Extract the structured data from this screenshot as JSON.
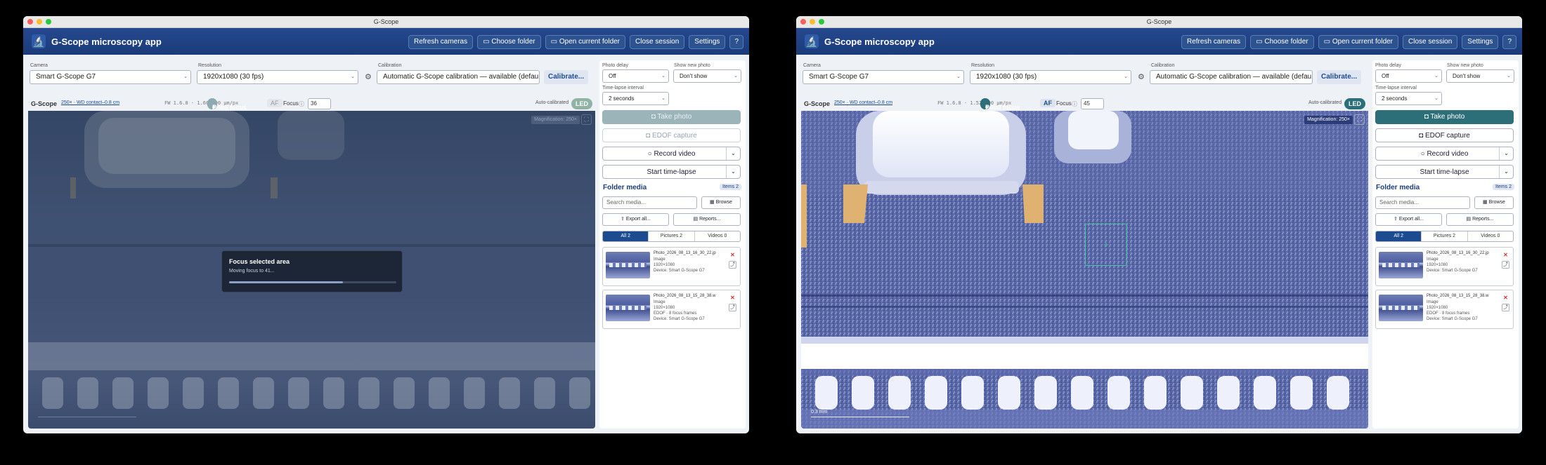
{
  "windows": [
    {
      "title": "G-Scope",
      "app_title": "G-Scope microscopy app",
      "top_buttons": [
        "Refresh cameras",
        "Choose folder",
        "Open current folder",
        "Close session",
        "Settings",
        "?"
      ],
      "camera_label": "Camera",
      "camera_value": "Smart G-Scope G7",
      "resolution_label": "Resolution",
      "resolution_value": "1920x1080 (30 fps)",
      "calibration_label": "Calibration",
      "calibration_value": "Automatic G-Scope calibration — available (defau",
      "calibrate_button": "Calibrate...",
      "brand": "G-Scope",
      "mag_link": "250× · WD contact–0.8 cm",
      "fw": "FW 1.6.8 · 1.602500 µm/px",
      "point_focus": "Point focus",
      "af": "AF",
      "focus_label": "Focus",
      "focus_value": "36",
      "auto_calibrated": "Auto-calibrated",
      "led": "LED",
      "magnification_tag": "Magnification: 250×",
      "scale_label": "",
      "overlay": {
        "title": "Focus selected area",
        "subtitle": "Moving focus to 41...",
        "progress": 0.68
      },
      "photo_delay_label": "Photo delay",
      "photo_delay_value": "Off",
      "show_new_photo_label": "Show new photo",
      "show_new_photo_value": "Don't show",
      "timelapse_label": "Time-lapse interval",
      "timelapse_value": "2 seconds",
      "take_photo": "Take photo",
      "edof_capture": "EDOF capture",
      "record_video": "Record video",
      "start_timelapse": "Start time-lapse",
      "folder_media": "Folder media",
      "items": "Items 2",
      "search_placeholder": "Search media...",
      "browse": "Browse",
      "export_all": "Export all...",
      "reports": "Reports...",
      "tabs": [
        "All 2",
        "Pictures 2",
        "Videos 0"
      ],
      "cards": [
        {
          "name": "Photo_2026_08_13_16_30_22.jp",
          "type": "Image",
          "res": "1920×1080",
          "extra": "",
          "device": "Device: Smart G-Scope G7"
        },
        {
          "name": "Photo_2026_08_13_15_28_38.w",
          "type": "Image",
          "res": "1920×1080",
          "extra": "EDOF · 8 focus frames",
          "device": "Device: Smart G-Scope G7"
        }
      ]
    },
    {
      "title": "G-Scope",
      "app_title": "G-Scope microscopy app",
      "top_buttons": [
        "Refresh cameras",
        "Choose folder",
        "Open current folder",
        "Close session",
        "Settings",
        "?"
      ],
      "camera_label": "Camera",
      "camera_value": "Smart G-Scope G7",
      "resolution_label": "Resolution",
      "resolution_value": "1920x1080 (30 fps)",
      "calibration_label": "Calibration",
      "calibration_value": "Automatic G-Scope calibration — available (defau",
      "calibrate_button": "Calibrate...",
      "brand": "G-Scope",
      "mag_link": "250× · WD contact–0.8 cm",
      "fw": "FW 1.6.8 · 1.525000 µm/px",
      "point_focus": "Point focus",
      "af": "AF",
      "focus_label": "Focus",
      "focus_value": "45",
      "auto_calibrated": "Auto-calibrated",
      "led": "LED",
      "magnification_tag": "Magnification: 250×",
      "scale_label": "0.3 mm",
      "photo_delay_label": "Photo delay",
      "photo_delay_value": "Off",
      "show_new_photo_label": "Show new photo",
      "show_new_photo_value": "Don't show",
      "timelapse_label": "Time-lapse interval",
      "timelapse_value": "2 seconds",
      "take_photo": "Take photo",
      "edof_capture": "EDOF capture",
      "record_video": "Record video",
      "start_timelapse": "Start time-lapse",
      "folder_media": "Folder media",
      "items": "Items 2",
      "search_placeholder": "Search media...",
      "browse": "Browse",
      "export_all": "Export all...",
      "reports": "Reports...",
      "tabs": [
        "All 2",
        "Pictures 2",
        "Videos 0"
      ],
      "cards": [
        {
          "name": "Photo_2026_08_13_16_30_22.jp",
          "type": "Image",
          "res": "1920×1080",
          "extra": "",
          "device": "Device: Smart G-Scope G7"
        },
        {
          "name": "Photo_2026_08_13_15_28_38.w",
          "type": "Image",
          "res": "1920×1080",
          "extra": "EDOF · 8 focus frames",
          "device": "Device: Smart G-Scope G7"
        }
      ]
    }
  ],
  "colors": {
    "appbar": "#1f4182",
    "accent": "#2c6f78",
    "point_focus_active": "#2c6f78",
    "point_focus_disabled": "#8fa9b4"
  }
}
